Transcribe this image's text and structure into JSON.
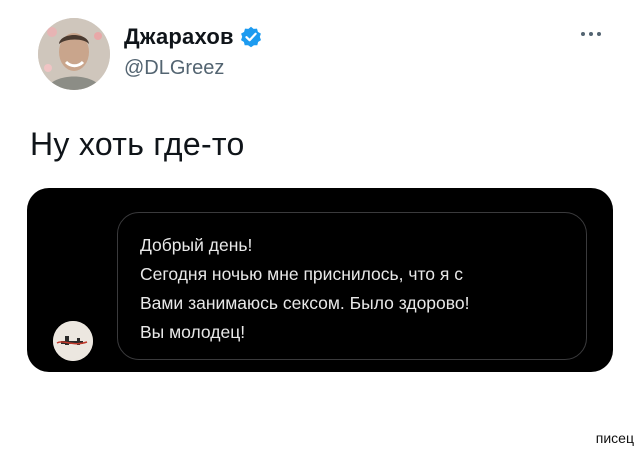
{
  "tweet": {
    "display_name": "Джарахов",
    "handle": "@DLGreez",
    "more_icon": "more-icon",
    "verified_color": "#1d9bf0",
    "text": "Ну хоть где-то"
  },
  "message_card": {
    "lines": [
      "Добрый день!",
      "Сегодня ночью мне приснилось, что я с",
      "Вами занимаюсь сексом. Было здорово!",
      "Вы молодец!"
    ]
  },
  "watermark": "писец"
}
